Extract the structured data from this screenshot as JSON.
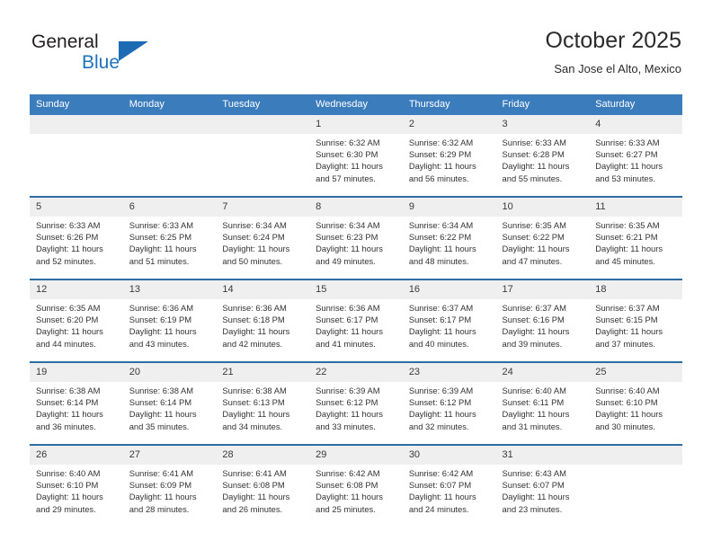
{
  "logo": {
    "word1": "General",
    "word2": "Blue",
    "triangle_color": "#1c6cb5",
    "icon": "triangle-icon"
  },
  "header": {
    "title": "October 2025",
    "subtitle": "San Jose el Alto, Mexico"
  },
  "colors": {
    "header_blue": "#3b7cbd",
    "row_rule_blue": "#2e6da4",
    "daystrip_grey": "#efefef",
    "text": "#333333"
  },
  "weekdays": [
    "Sunday",
    "Monday",
    "Tuesday",
    "Wednesday",
    "Thursday",
    "Friday",
    "Saturday"
  ],
  "weeks": [
    [
      {
        "day": "",
        "sunrise": "",
        "sunset": "",
        "daylight1": "",
        "daylight2": ""
      },
      {
        "day": "",
        "sunrise": "",
        "sunset": "",
        "daylight1": "",
        "daylight2": ""
      },
      {
        "day": "",
        "sunrise": "",
        "sunset": "",
        "daylight1": "",
        "daylight2": ""
      },
      {
        "day": "1",
        "sunrise": "Sunrise: 6:32 AM",
        "sunset": "Sunset: 6:30 PM",
        "daylight1": "Daylight: 11 hours",
        "daylight2": "and 57 minutes."
      },
      {
        "day": "2",
        "sunrise": "Sunrise: 6:32 AM",
        "sunset": "Sunset: 6:29 PM",
        "daylight1": "Daylight: 11 hours",
        "daylight2": "and 56 minutes."
      },
      {
        "day": "3",
        "sunrise": "Sunrise: 6:33 AM",
        "sunset": "Sunset: 6:28 PM",
        "daylight1": "Daylight: 11 hours",
        "daylight2": "and 55 minutes."
      },
      {
        "day": "4",
        "sunrise": "Sunrise: 6:33 AM",
        "sunset": "Sunset: 6:27 PM",
        "daylight1": "Daylight: 11 hours",
        "daylight2": "and 53 minutes."
      }
    ],
    [
      {
        "day": "5",
        "sunrise": "Sunrise: 6:33 AM",
        "sunset": "Sunset: 6:26 PM",
        "daylight1": "Daylight: 11 hours",
        "daylight2": "and 52 minutes."
      },
      {
        "day": "6",
        "sunrise": "Sunrise: 6:33 AM",
        "sunset": "Sunset: 6:25 PM",
        "daylight1": "Daylight: 11 hours",
        "daylight2": "and 51 minutes."
      },
      {
        "day": "7",
        "sunrise": "Sunrise: 6:34 AM",
        "sunset": "Sunset: 6:24 PM",
        "daylight1": "Daylight: 11 hours",
        "daylight2": "and 50 minutes."
      },
      {
        "day": "8",
        "sunrise": "Sunrise: 6:34 AM",
        "sunset": "Sunset: 6:23 PM",
        "daylight1": "Daylight: 11 hours",
        "daylight2": "and 49 minutes."
      },
      {
        "day": "9",
        "sunrise": "Sunrise: 6:34 AM",
        "sunset": "Sunset: 6:22 PM",
        "daylight1": "Daylight: 11 hours",
        "daylight2": "and 48 minutes."
      },
      {
        "day": "10",
        "sunrise": "Sunrise: 6:35 AM",
        "sunset": "Sunset: 6:22 PM",
        "daylight1": "Daylight: 11 hours",
        "daylight2": "and 47 minutes."
      },
      {
        "day": "11",
        "sunrise": "Sunrise: 6:35 AM",
        "sunset": "Sunset: 6:21 PM",
        "daylight1": "Daylight: 11 hours",
        "daylight2": "and 45 minutes."
      }
    ],
    [
      {
        "day": "12",
        "sunrise": "Sunrise: 6:35 AM",
        "sunset": "Sunset: 6:20 PM",
        "daylight1": "Daylight: 11 hours",
        "daylight2": "and 44 minutes."
      },
      {
        "day": "13",
        "sunrise": "Sunrise: 6:36 AM",
        "sunset": "Sunset: 6:19 PM",
        "daylight1": "Daylight: 11 hours",
        "daylight2": "and 43 minutes."
      },
      {
        "day": "14",
        "sunrise": "Sunrise: 6:36 AM",
        "sunset": "Sunset: 6:18 PM",
        "daylight1": "Daylight: 11 hours",
        "daylight2": "and 42 minutes."
      },
      {
        "day": "15",
        "sunrise": "Sunrise: 6:36 AM",
        "sunset": "Sunset: 6:17 PM",
        "daylight1": "Daylight: 11 hours",
        "daylight2": "and 41 minutes."
      },
      {
        "day": "16",
        "sunrise": "Sunrise: 6:37 AM",
        "sunset": "Sunset: 6:17 PM",
        "daylight1": "Daylight: 11 hours",
        "daylight2": "and 40 minutes."
      },
      {
        "day": "17",
        "sunrise": "Sunrise: 6:37 AM",
        "sunset": "Sunset: 6:16 PM",
        "daylight1": "Daylight: 11 hours",
        "daylight2": "and 39 minutes."
      },
      {
        "day": "18",
        "sunrise": "Sunrise: 6:37 AM",
        "sunset": "Sunset: 6:15 PM",
        "daylight1": "Daylight: 11 hours",
        "daylight2": "and 37 minutes."
      }
    ],
    [
      {
        "day": "19",
        "sunrise": "Sunrise: 6:38 AM",
        "sunset": "Sunset: 6:14 PM",
        "daylight1": "Daylight: 11 hours",
        "daylight2": "and 36 minutes."
      },
      {
        "day": "20",
        "sunrise": "Sunrise: 6:38 AM",
        "sunset": "Sunset: 6:14 PM",
        "daylight1": "Daylight: 11 hours",
        "daylight2": "and 35 minutes."
      },
      {
        "day": "21",
        "sunrise": "Sunrise: 6:38 AM",
        "sunset": "Sunset: 6:13 PM",
        "daylight1": "Daylight: 11 hours",
        "daylight2": "and 34 minutes."
      },
      {
        "day": "22",
        "sunrise": "Sunrise: 6:39 AM",
        "sunset": "Sunset: 6:12 PM",
        "daylight1": "Daylight: 11 hours",
        "daylight2": "and 33 minutes."
      },
      {
        "day": "23",
        "sunrise": "Sunrise: 6:39 AM",
        "sunset": "Sunset: 6:12 PM",
        "daylight1": "Daylight: 11 hours",
        "daylight2": "and 32 minutes."
      },
      {
        "day": "24",
        "sunrise": "Sunrise: 6:40 AM",
        "sunset": "Sunset: 6:11 PM",
        "daylight1": "Daylight: 11 hours",
        "daylight2": "and 31 minutes."
      },
      {
        "day": "25",
        "sunrise": "Sunrise: 6:40 AM",
        "sunset": "Sunset: 6:10 PM",
        "daylight1": "Daylight: 11 hours",
        "daylight2": "and 30 minutes."
      }
    ],
    [
      {
        "day": "26",
        "sunrise": "Sunrise: 6:40 AM",
        "sunset": "Sunset: 6:10 PM",
        "daylight1": "Daylight: 11 hours",
        "daylight2": "and 29 minutes."
      },
      {
        "day": "27",
        "sunrise": "Sunrise: 6:41 AM",
        "sunset": "Sunset: 6:09 PM",
        "daylight1": "Daylight: 11 hours",
        "daylight2": "and 28 minutes."
      },
      {
        "day": "28",
        "sunrise": "Sunrise: 6:41 AM",
        "sunset": "Sunset: 6:08 PM",
        "daylight1": "Daylight: 11 hours",
        "daylight2": "and 26 minutes."
      },
      {
        "day": "29",
        "sunrise": "Sunrise: 6:42 AM",
        "sunset": "Sunset: 6:08 PM",
        "daylight1": "Daylight: 11 hours",
        "daylight2": "and 25 minutes."
      },
      {
        "day": "30",
        "sunrise": "Sunrise: 6:42 AM",
        "sunset": "Sunset: 6:07 PM",
        "daylight1": "Daylight: 11 hours",
        "daylight2": "and 24 minutes."
      },
      {
        "day": "31",
        "sunrise": "Sunrise: 6:43 AM",
        "sunset": "Sunset: 6:07 PM",
        "daylight1": "Daylight: 11 hours",
        "daylight2": "and 23 minutes."
      },
      {
        "day": "",
        "sunrise": "",
        "sunset": "",
        "daylight1": "",
        "daylight2": ""
      }
    ]
  ]
}
